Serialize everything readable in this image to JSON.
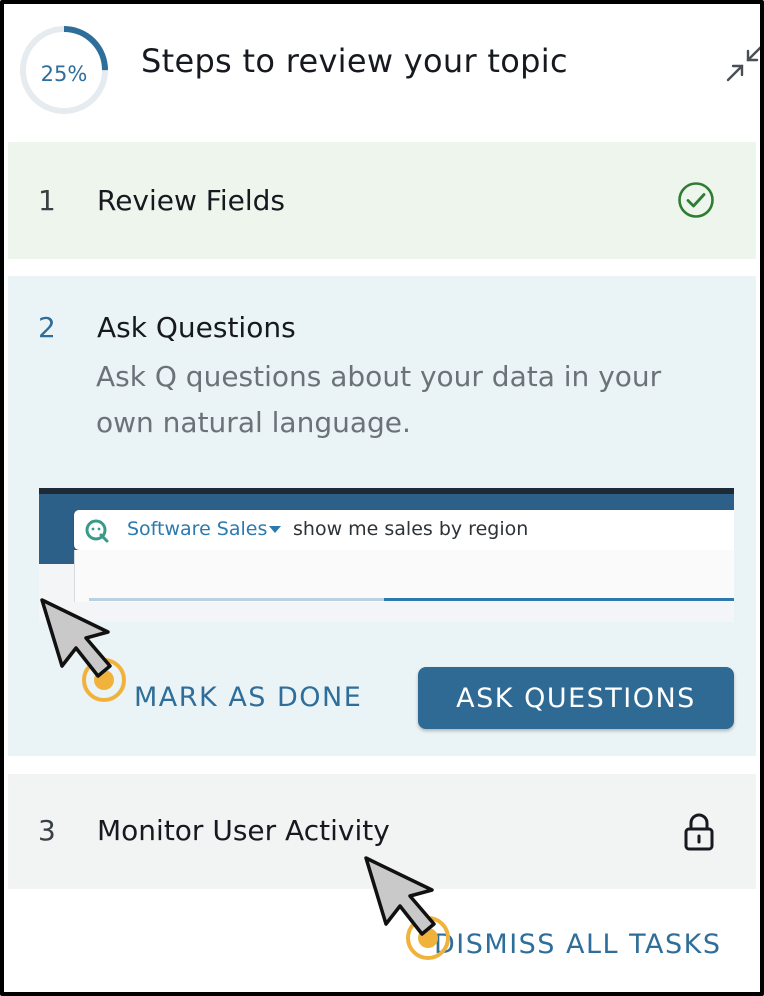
{
  "header": {
    "progress_label": "25%",
    "progress_fraction": 0.25,
    "title": "Steps to review your topic",
    "collapse_icon": "collapse-arrows-icon"
  },
  "steps": [
    {
      "number": "1",
      "title": "Review Fields",
      "status": "done",
      "status_icon": "check-circle-icon"
    },
    {
      "number": "2",
      "title": "Ask Questions",
      "description": "Ask Q questions about your data in your own natural language.",
      "status": "active",
      "preview": {
        "topic": "Software Sales",
        "query": "show me sales by region"
      },
      "mark_done_label": "MARK AS DONE",
      "ask_button_label": "ASK QUESTIONS"
    },
    {
      "number": "3",
      "title": "Monitor User Activity",
      "status": "locked",
      "status_icon": "lock-icon"
    }
  ],
  "footer": {
    "dismiss_label": "DISMISS ALL TASKS"
  },
  "colors": {
    "accent": "#2f6e9a",
    "done_bg": "#eef5ec",
    "active_bg": "#eaf3f5",
    "locked_bg": "#f2f3f3",
    "check": "#2e7d32",
    "highlight": "#f0b23a"
  }
}
